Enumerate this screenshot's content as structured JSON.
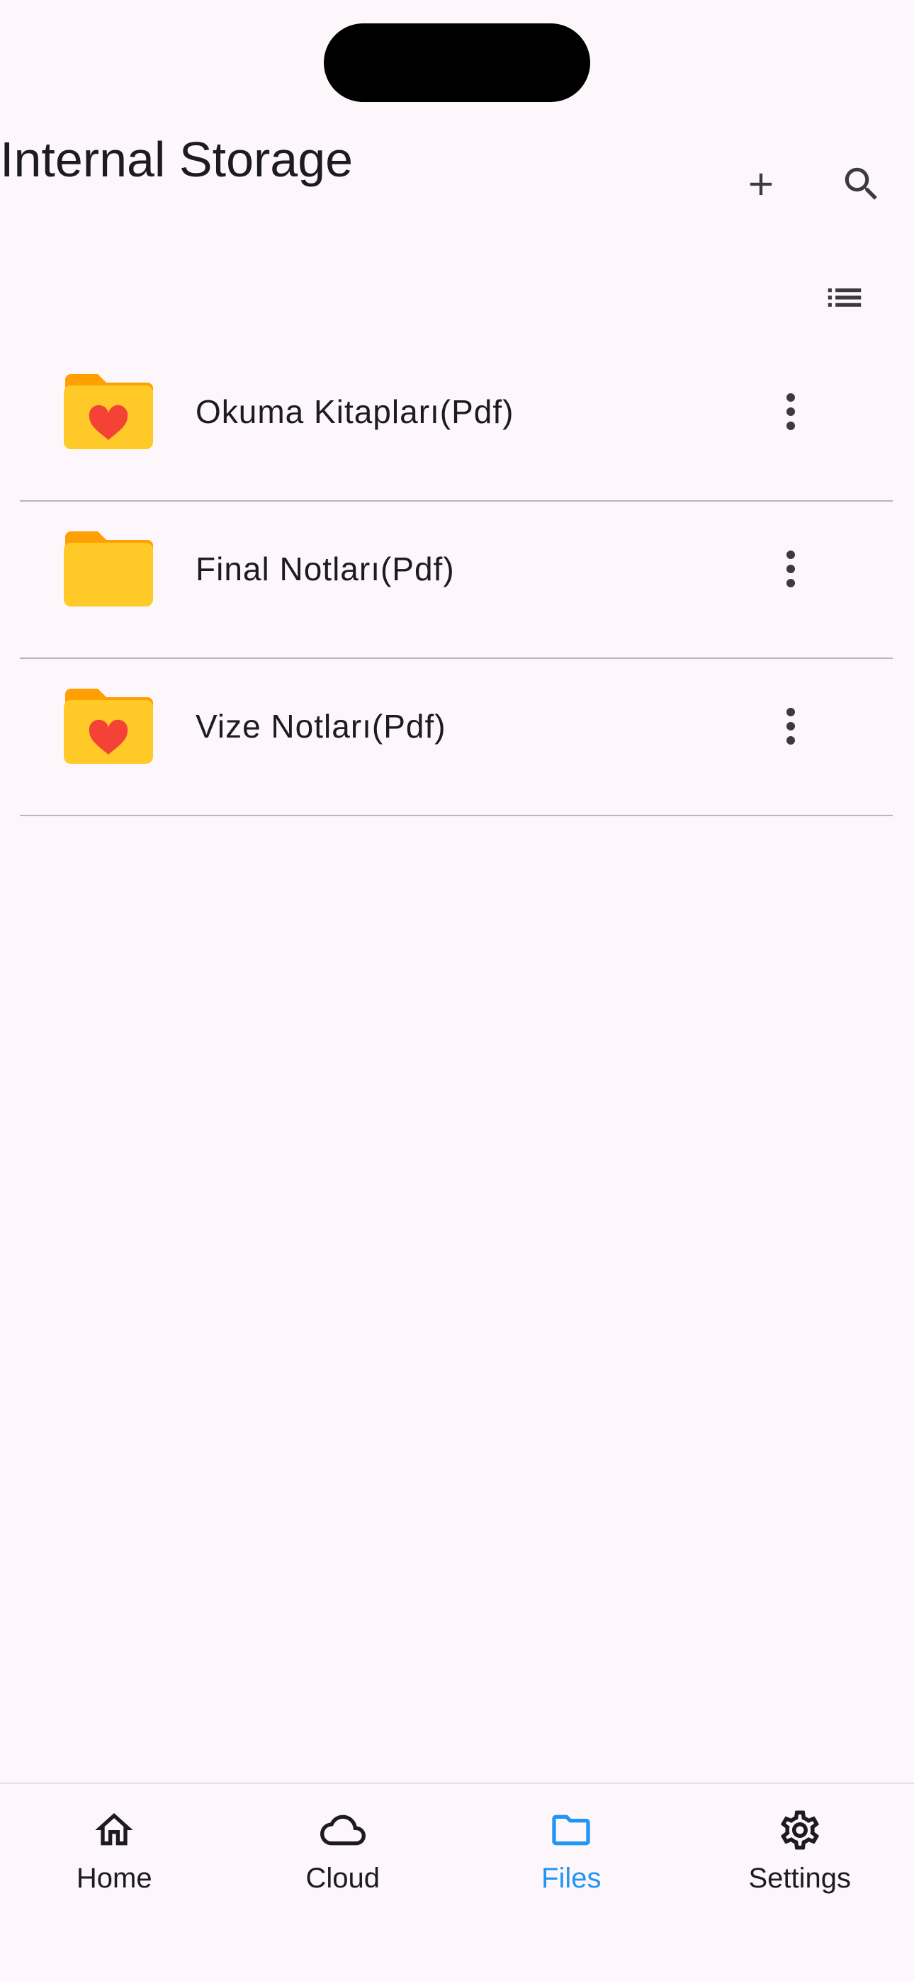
{
  "header": {
    "title": "Internal Storage",
    "add_icon": "plus-icon",
    "search_icon": "search-icon",
    "view_icon": "list-view-icon"
  },
  "folders": [
    {
      "label": "Okuma Kitapları(Pdf)",
      "favorite": true
    },
    {
      "label": "Final Notları(Pdf)",
      "favorite": false
    },
    {
      "label": "Vize Notları(Pdf)",
      "favorite": true
    }
  ],
  "bottom_nav": {
    "items": [
      {
        "label": "Home",
        "icon": "home-icon",
        "active": false
      },
      {
        "label": "Cloud",
        "icon": "cloud-icon",
        "active": false
      },
      {
        "label": "Files",
        "icon": "folder-icon",
        "active": true
      },
      {
        "label": "Settings",
        "icon": "gear-icon",
        "active": false
      }
    ]
  },
  "colors": {
    "background": "#fdf7fc",
    "folder_front": "#ffca28",
    "folder_back": "#ffa000",
    "heart": "#f44336",
    "active_nav": "#2196f3",
    "divider": "#b8b5bb"
  }
}
